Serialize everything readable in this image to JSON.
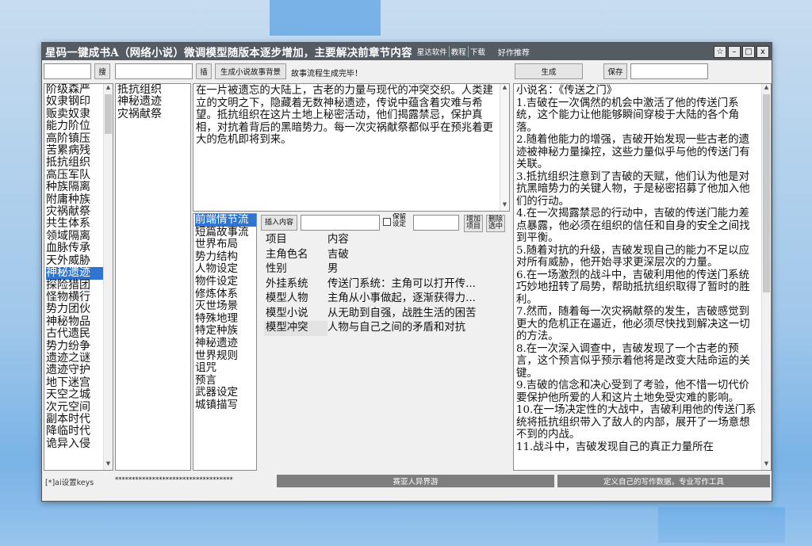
{
  "window": {
    "title": "星码一键成书A（网络小说）微调模型随版本逐步增加，主要解决前章节内容",
    "links": [
      "星达软件",
      "教程",
      "下载"
    ],
    "recommend": "好作推荐",
    "controls": [
      "☆",
      "–",
      "□",
      "x"
    ]
  },
  "toolbar": {
    "search_button": "搜",
    "insert_button": "插",
    "gen_background_button": "生成小说故事背景",
    "status": "故事流程生成完毕！",
    "generate_button": "生成",
    "save_button": "保存"
  },
  "left_list": {
    "items": [
      "阶级森严",
      "奴隶钢印",
      "贩卖奴隶",
      "能力阶位",
      "高阶镇压",
      "苦累病残",
      "抵抗组织",
      "高压军队",
      "种族隔离",
      "附庸种族",
      "灾祸献祭",
      "共生体系",
      "领域隔离",
      "血脉传承",
      "天外威胁",
      "神秘遗迹",
      "探险猎团",
      "怪物横行",
      "势力团伙",
      "神秘物品",
      "古代遗民",
      "势力纷争",
      "遗迹之谜",
      "遗迹守护",
      "地下迷宫",
      "天空之城",
      "次元空间",
      "副本时代",
      "降临时代",
      "诡异入侵"
    ],
    "selected": "神秘遗迹"
  },
  "selected_list": {
    "items": [
      "抵抗组织",
      "神秘遗迹",
      "灾祸献祭"
    ]
  },
  "story_background": {
    "text": "在一片被遗忘的大陆上，古老的力量与现代的冲突交织。人类建立的文明之下，隐藏着无数神秘遗迹，传说中蕴含着灾难与希望。抵抗组织在这片土地上秘密活动，他们揭露禁忌，保护真相，对抗着背后的黑暗势力。每一次灾祸献祭都似乎在预兆着更大的危机即将到来。"
  },
  "categories": {
    "items": [
      "前端情节流",
      "短篇故事流",
      "世界布局",
      "势力结构",
      "人物设定",
      "物件设定",
      "修炼体系",
      "灭世场景",
      "特殊地理",
      "特定种族",
      "神秘遗迹",
      "世界规则",
      "诅咒",
      "预言",
      "武器设定",
      "城镇描写"
    ],
    "selected": "前端情节流"
  },
  "insert_row": {
    "insert_content_button": "插入内容",
    "keep_setting_label": "保留设定",
    "add_item_button": "增加项目",
    "delete_selected_button": "删除选中"
  },
  "settings_table": {
    "header": {
      "key": "项目",
      "value": "内容"
    },
    "rows": [
      {
        "key": "主角色名",
        "value": "吉破"
      },
      {
        "key": "性别",
        "value": "男"
      },
      {
        "key": "外挂系统",
        "value": "传送门系统：主角可以打开传..."
      },
      {
        "key": "模型人物",
        "value": "主角从小事做起，逐渐获得力..."
      },
      {
        "key": "模型小说",
        "value": "从无助到自强，战胜生活的困苦"
      },
      {
        "key": "模型冲突",
        "value": "人物与自己之间的矛盾和对抗"
      }
    ]
  },
  "output": {
    "text": "小说名：《传送之门》\n1.吉破在一次偶然的机会中激活了他的传送门系统，这个能力让他能够瞬间穿梭于大陆的各个角落。\n2.随着他能力的增强，吉破开始发现一些古老的遗迹被神秘力量操控，这些力量似乎与他的传送门有关联。\n3.抵抗组织注意到了吉破的天赋，他们认为他是对抗黑暗势力的关键人物，于是秘密招募了他加入他们的行动。\n4.在一次揭露禁忌的行动中，吉破的传送门能力差点暴露，他必须在组织的信任和自身的安全之间找到平衡。\n5.随着对抗的升级，吉破发现自己的能力不足以应对所有威胁，他开始寻求更深层次的力量。\n6.在一场激烈的战斗中，吉破利用他的传送门系统巧妙地扭转了局势，帮助抵抗组织取得了暂时的胜利。\n7.然而，随着每一次灾祸献祭的发生，吉破感觉到更大的危机正在逼近，他必须尽快找到解决这一切的方法。\n8.在一次深入调查中，吉破发现了一个古老的预言，这个预言似乎预示着他将是改变大陆命运的关键。\n9.吉破的信念和决心受到了考验，他不惜一切代价要保护他所爱的人和这片土地免受灾难的影响。\n10.在一场决定性的大战中，吉破利用他的传送门系统将抵抗组织带入了敌人的内部，展开了一场意想不到的内战。\n11.战斗中，吉破发现自己的真正力量所在"
  },
  "statusbar": {
    "ai_settings": "[*]ai设置keys",
    "masked_key": "***********************************",
    "middle": "赛亚人异界游",
    "right": "定义自己的写作数据，专业写作工具"
  }
}
